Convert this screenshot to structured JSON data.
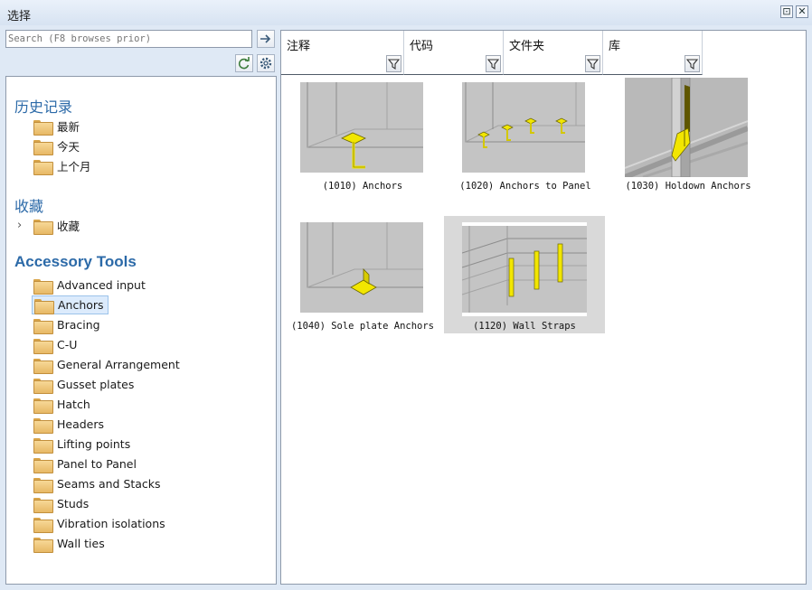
{
  "window": {
    "title": "选择",
    "restore_glyph": "⊡",
    "close_glyph": "✕"
  },
  "search": {
    "placeholder": "Search (F8 browses prior)",
    "value": ""
  },
  "icons": {
    "go": "arrow-right-icon",
    "refresh": "refresh-icon",
    "settings": "gear-icon",
    "filter": "filter-icon",
    "folder": "folder-icon",
    "expand": "chevron-right-icon"
  },
  "sidebar": {
    "history_title": "历史记录",
    "history_items": [
      "最新",
      "今天",
      "上个月"
    ],
    "favorites_title": "收藏",
    "favorites_items": [
      "收藏"
    ],
    "favorites_chevron": "›",
    "accessory_title": "Accessory Tools",
    "accessory_items": [
      "Advanced input",
      "Anchors",
      "Bracing",
      "C-U",
      "General Arrangement",
      "Gusset plates",
      "Hatch",
      "Headers",
      "Lifting points",
      "Panel to Panel",
      "Seams and Stacks",
      "Studs",
      "Vibration isolations",
      "Wall ties"
    ],
    "selected_item": "Anchors"
  },
  "columns": [
    "注释",
    "代码",
    "文件夹",
    "库"
  ],
  "tiles": [
    {
      "label": "(1010) Anchors"
    },
    {
      "label": "(1020) Anchors to Panel"
    },
    {
      "label": "(1030) Holdown Anchors"
    },
    {
      "label": "(1040) Sole plate Anchors"
    },
    {
      "label": "(1120) Wall Straps"
    }
  ],
  "selected_tile": "(1120) Wall Straps",
  "colors": {
    "accent_heading": "#2c6aa8",
    "part_yellow": "#f2e600",
    "thumb_bg": "#c4c4c4",
    "selection": "#dcebfc"
  }
}
